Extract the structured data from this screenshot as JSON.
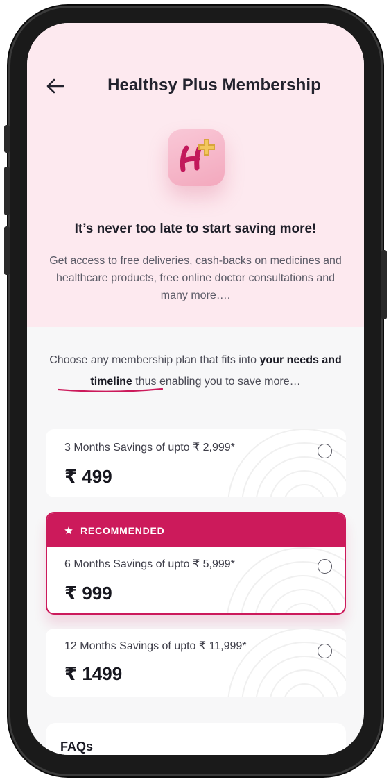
{
  "header": {
    "title": "Healthsy Plus Membership"
  },
  "hero": {
    "headline": "It’s never too late to start saving more!",
    "description": "Get access to free deliveries, cash-backs on medicines and healthcare products, free online doctor consultations and many more…."
  },
  "intro": {
    "text_before": "Choose any membership plan that fits into ",
    "text_bold": "your needs and timeline",
    "text_after": " thus enabling you to save more…"
  },
  "plans": [
    {
      "label": "3 Months  Savings of upto ₹ 2,999*",
      "price": "₹ 499",
      "selected": false,
      "recommended": false
    },
    {
      "label": "6 Months Savings of upto ₹ 5,999*",
      "price": "₹ 999",
      "selected": false,
      "recommended": true,
      "badge": "RECOMMENDED"
    },
    {
      "label": "12 Months Savings of upto ₹ 11,999*",
      "price": "₹ 1499",
      "selected": false,
      "recommended": false
    }
  ],
  "faq": {
    "title": "FAQs"
  },
  "colors": {
    "brand_primary": "#cc1a5b",
    "hero_background": "#fde9ef",
    "page_background": "#f7f7f8"
  },
  "icons": {
    "back": "arrow-left-icon",
    "logo": "healthsy-plus-logo",
    "badge": "star-icon"
  }
}
